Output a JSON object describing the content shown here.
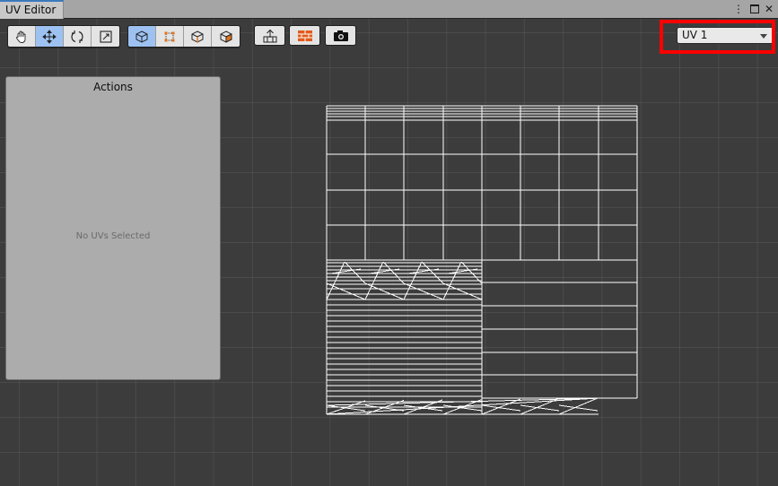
{
  "window": {
    "tab_title": "UV Editor",
    "controls": {
      "menu": "⋮",
      "maximize": "□",
      "close": "✕"
    }
  },
  "toolbar": {
    "transform_tools": [
      {
        "name": "hand-tool",
        "icon": "hand-icon",
        "active": false
      },
      {
        "name": "move-tool",
        "icon": "move-arrows-icon",
        "active": true
      },
      {
        "name": "rotate-tool",
        "icon": "rotate-icon",
        "active": false
      },
      {
        "name": "scale-tool",
        "icon": "scale-icon",
        "active": false
      }
    ],
    "selection_modes": [
      {
        "name": "object-mode",
        "icon": "cube-outline-icon",
        "active": true
      },
      {
        "name": "vertex-mode",
        "icon": "vertex-square-icon",
        "active": false
      },
      {
        "name": "edge-mode",
        "icon": "cube-edge-icon",
        "active": false
      },
      {
        "name": "face-mode",
        "icon": "cube-face-icon",
        "active": false
      }
    ],
    "actions": [
      {
        "name": "export-uv-button",
        "icon": "export-arrow-icon"
      },
      {
        "name": "atlas-button",
        "icon": "brick-grid-icon"
      },
      {
        "name": "screenshot-button",
        "icon": "camera-icon"
      }
    ]
  },
  "uv_channel": {
    "selected": "UV 1",
    "highlighted": true
  },
  "actions_panel": {
    "title": "Actions",
    "empty_message": "No UVs Selected"
  },
  "colors": {
    "background": "#3c3c3c",
    "panel": "#acacac",
    "active_button": "#9dc2f2",
    "highlight": "#ff0000",
    "mesh_line": "#ffffff",
    "atlas_icon": "#e25b1c"
  }
}
